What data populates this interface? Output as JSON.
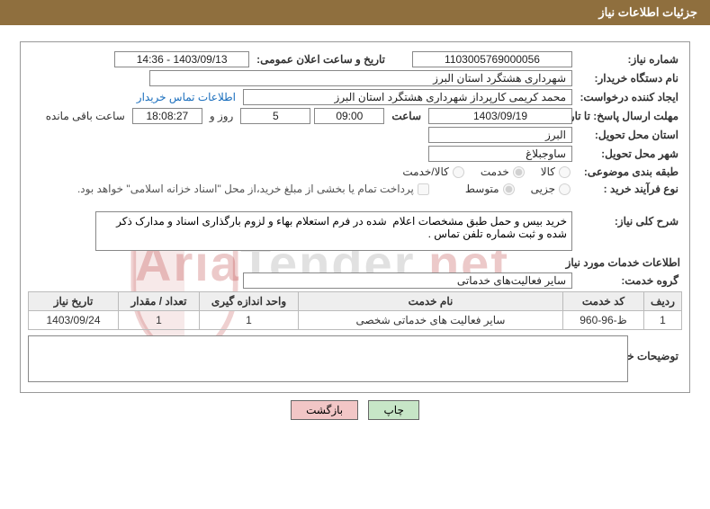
{
  "header": {
    "title": "جزئیات اطلاعات نیاز"
  },
  "form": {
    "need_no_label": "شماره نیاز:",
    "need_no": "1103005769000056",
    "announce_label": "تاریخ و ساعت اعلان عمومی:",
    "announce_value": "1403/09/13 - 14:36",
    "buyer_org_label": "نام دستگاه خریدار:",
    "buyer_org": "شهرداری هشتگرد استان البرز",
    "requester_label": "ایجاد کننده درخواست:",
    "requester": "محمد کریمی کارپرداز شهرداری هشتگرد استان البرز",
    "contact_link": "اطلاعات تماس خریدار",
    "deadline_label": "مهلت ارسال پاسخ: تا تاریخ:",
    "deadline_date": "1403/09/19",
    "time_label": "ساعت",
    "deadline_time": "09:00",
    "days_remaining": "5",
    "days_and_word": "روز و",
    "time_remaining": "18:08:27",
    "remaining_suffix": "ساعت باقی مانده",
    "delivery_province_label": "استان محل تحویل:",
    "delivery_province": "البرز",
    "delivery_city_label": "شهر محل تحویل:",
    "delivery_city": "ساوجبلاغ",
    "category_label": "طبقه بندی موضوعی:",
    "cat_goods": "کالا",
    "cat_service": "خدمت",
    "cat_goods_service": "کالا/خدمت",
    "purchase_type_label": "نوع فرآیند خرید :",
    "pt_partial": "جزیی",
    "pt_medium": "متوسط",
    "treasury_note": "پرداخت تمام یا بخشی از مبلغ خرید،از محل \"اسناد خزانه اسلامی\" خواهد بود.",
    "desc_label": "شرح کلی نیاز:",
    "desc_value": "خرید بیس و حمل طبق مشخصات اعلام  شده در فرم استعلام بهاء و لزوم بارگذاری اسناد و مدارک ذکر شده و ثبت شماره تلفن تماس .",
    "services_info_title": "اطلاعات خدمات مورد نیاز",
    "service_group_label": "گروه خدمت:",
    "service_group": "سایر فعالیت‌های خدماتی",
    "buyer_comment_label": "توضیحات خریدار:",
    "buyer_comment": ""
  },
  "table": {
    "headers": {
      "row": "ردیف",
      "code": "کد خدمت",
      "name": "نام خدمت",
      "unit": "واحد اندازه گیری",
      "qty": "تعداد / مقدار",
      "date": "تاریخ نیاز"
    },
    "rows": [
      {
        "row": "1",
        "code": "ظ-96-960",
        "name": "سایر فعالیت های خدماتی شخصی",
        "unit": "1",
        "qty": "1",
        "date": "1403/09/24"
      }
    ]
  },
  "buttons": {
    "print": "چاپ",
    "back": "بازگشت"
  },
  "watermark": {
    "text_a": "Aria",
    "text_b": "Tender",
    "text_c": ".net"
  }
}
